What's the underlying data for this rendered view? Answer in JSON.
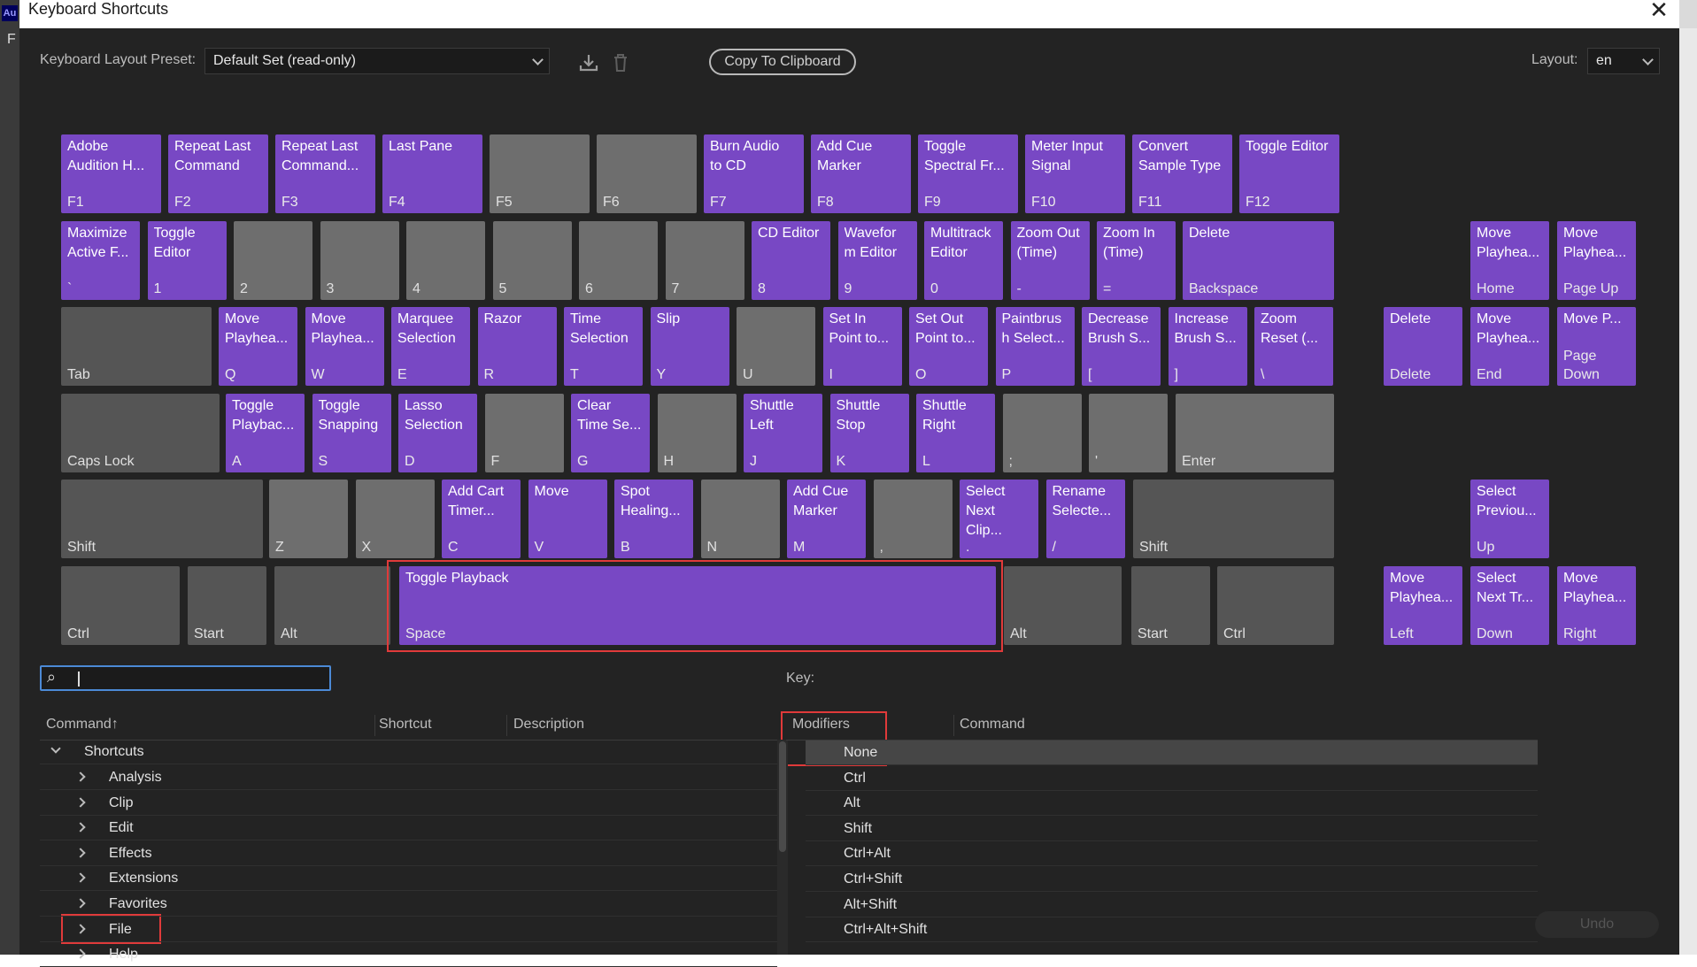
{
  "window": {
    "title": "Keyboard Shortcuts",
    "close_glyph": "✕"
  },
  "app_strip": {
    "badge": "Au",
    "letter": "F"
  },
  "toolbar": {
    "preset_label": "Keyboard Layout Preset:",
    "preset_value": "Default Set (read-only)",
    "save_icon": "download-icon",
    "delete_icon": "trash-icon",
    "copy_label": "Copy To Clipboard",
    "layout_label": "Layout:",
    "layout_value": "en"
  },
  "keyboard": {
    "function_row": [
      {
        "cmd": "Adobe\nAudition H...",
        "label": "F1"
      },
      {
        "cmd": "Repeat Last\nCommand",
        "label": "F2"
      },
      {
        "cmd": "Repeat Last\nCommand...",
        "label": "F3"
      },
      {
        "cmd": "Last Pane",
        "label": "F4"
      },
      {
        "cmd": "",
        "label": "F5"
      },
      {
        "cmd": "",
        "label": "F6"
      },
      {
        "cmd": "Burn Audio\nto CD",
        "label": "F7"
      },
      {
        "cmd": "Add Cue\nMarker",
        "label": "F8"
      },
      {
        "cmd": "Toggle\nSpectral Fr...",
        "label": "F9"
      },
      {
        "cmd": "Meter Input\nSignal",
        "label": "F10"
      },
      {
        "cmd": "Convert\nSample Type",
        "label": "F11"
      },
      {
        "cmd": "Toggle Editor",
        "label": "F12"
      }
    ],
    "number_row": [
      {
        "cmd": "Maximize\nActive F...",
        "label": "`"
      },
      {
        "cmd": "Toggle\nEditor",
        "label": "1"
      },
      {
        "cmd": "",
        "label": "2"
      },
      {
        "cmd": "",
        "label": "3"
      },
      {
        "cmd": "",
        "label": "4"
      },
      {
        "cmd": "",
        "label": "5"
      },
      {
        "cmd": "",
        "label": "6"
      },
      {
        "cmd": "",
        "label": "7"
      },
      {
        "cmd": "CD Editor",
        "label": "8"
      },
      {
        "cmd": "Wavefor\nm Editor",
        "label": "9"
      },
      {
        "cmd": "Multitrack\nEditor",
        "label": "0"
      },
      {
        "cmd": "Zoom Out\n(Time)",
        "label": "-"
      },
      {
        "cmd": "Zoom In\n(Time)",
        "label": "="
      },
      {
        "cmd": "Delete",
        "label": "Backspace"
      }
    ],
    "q_row": [
      {
        "cmd": "",
        "label": "Tab"
      },
      {
        "cmd": "Move\nPlayhea...",
        "label": "Q"
      },
      {
        "cmd": "Move\nPlayhea...",
        "label": "W"
      },
      {
        "cmd": "Marquee\nSelection",
        "label": "E"
      },
      {
        "cmd": "Razor",
        "label": "R"
      },
      {
        "cmd": "Time\nSelection",
        "label": "T"
      },
      {
        "cmd": "Slip",
        "label": "Y"
      },
      {
        "cmd": "",
        "label": "U"
      },
      {
        "cmd": "Set In\nPoint to...",
        "label": "I"
      },
      {
        "cmd": "Set Out\nPoint to...",
        "label": "O"
      },
      {
        "cmd": "Paintbrus\nh Select...",
        "label": "P"
      },
      {
        "cmd": "Decrease\nBrush S...",
        "label": "["
      },
      {
        "cmd": "Increase\nBrush S...",
        "label": "]"
      },
      {
        "cmd": "Zoom\nReset (...",
        "label": "\\"
      }
    ],
    "a_row": [
      {
        "cmd": "",
        "label": "Caps Lock"
      },
      {
        "cmd": "Toggle\nPlaybac...",
        "label": "A"
      },
      {
        "cmd": "Toggle\nSnapping",
        "label": "S"
      },
      {
        "cmd": "Lasso\nSelection",
        "label": "D"
      },
      {
        "cmd": "",
        "label": "F"
      },
      {
        "cmd": "Clear\nTime Se...",
        "label": "G"
      },
      {
        "cmd": "",
        "label": "H"
      },
      {
        "cmd": "Shuttle\nLeft",
        "label": "J"
      },
      {
        "cmd": "Shuttle\nStop",
        "label": "K"
      },
      {
        "cmd": "Shuttle\nRight",
        "label": "L"
      },
      {
        "cmd": "",
        "label": ";"
      },
      {
        "cmd": "",
        "label": "'"
      },
      {
        "cmd": "",
        "label": "Enter"
      }
    ],
    "z_row": [
      {
        "cmd": "",
        "label": "Shift"
      },
      {
        "cmd": "",
        "label": "Z"
      },
      {
        "cmd": "",
        "label": "X"
      },
      {
        "cmd": "Add Cart\nTimer...",
        "label": "C"
      },
      {
        "cmd": "Move",
        "label": "V"
      },
      {
        "cmd": "Spot\nHealing...",
        "label": "B"
      },
      {
        "cmd": "",
        "label": "N"
      },
      {
        "cmd": "Add Cue\nMarker",
        "label": "M"
      },
      {
        "cmd": "",
        "label": ","
      },
      {
        "cmd": "Select\nNext\nClip...",
        "label": "."
      },
      {
        "cmd": "Rename\nSelecte...",
        "label": "/"
      },
      {
        "cmd": "",
        "label": "Shift"
      }
    ],
    "bottom_row": [
      {
        "cmd": "",
        "label": "Ctrl"
      },
      {
        "cmd": "",
        "label": "Start"
      },
      {
        "cmd": "",
        "label": "Alt"
      },
      {
        "cmd": "Toggle Playback",
        "label": "Space"
      },
      {
        "cmd": "",
        "label": "Alt"
      },
      {
        "cmd": "",
        "label": "Start"
      },
      {
        "cmd": "",
        "label": "Ctrl"
      }
    ],
    "nav_cluster": [
      {
        "cmd": "Move\nPlayhea...",
        "label": "Home"
      },
      {
        "cmd": "Move\nPlayhea...",
        "label": "Page Up"
      },
      {
        "cmd": "Delete",
        "label": "Delete"
      },
      {
        "cmd": "Move\nPlayhea...",
        "label": "End"
      },
      {
        "cmd": "Move P...",
        "label": "Page\nDown"
      }
    ],
    "arrow_cluster": [
      {
        "cmd": "Select\nPreviou...",
        "label": "Up"
      },
      {
        "cmd": "Move\nPlayhea...",
        "label": "Left"
      },
      {
        "cmd": "Select\nNext Tr...",
        "label": "Down"
      },
      {
        "cmd": "Move\nPlayhea...",
        "label": "Right"
      }
    ]
  },
  "search": {
    "icon": "search-icon",
    "value": ""
  },
  "key_panel": {
    "label": "Key:"
  },
  "command_list": {
    "headers": {
      "command": "Command",
      "sort_glyph": "↑",
      "shortcut": "Shortcut",
      "description": "Description"
    },
    "root": "Shortcuts",
    "groups": [
      "Analysis",
      "Clip",
      "Edit",
      "Effects",
      "Extensions",
      "Favorites",
      "File",
      "Help"
    ]
  },
  "modifiers_table": {
    "headers": {
      "modifiers": "Modifiers",
      "command": "Command"
    },
    "rows": [
      "None",
      "Ctrl",
      "Alt",
      "Shift",
      "Ctrl+Alt",
      "Ctrl+Shift",
      "Alt+Shift",
      "Ctrl+Alt+Shift"
    ],
    "selected": "None"
  },
  "footer": {
    "undo_label": "Undo"
  },
  "colors": {
    "assigned_key": "#7848c4",
    "unassigned_key": "#6e6e6e",
    "modifier_key": "#555555",
    "highlight": "#e03a3a",
    "background": "#232323"
  }
}
